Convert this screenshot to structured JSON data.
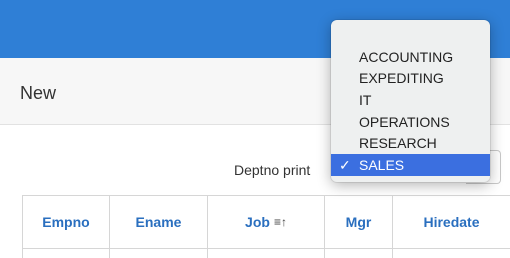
{
  "header": {
    "new_title": "New"
  },
  "filter": {
    "label": "Deptno print",
    "options": [
      "ACCOUNTING",
      "EXPEDITING",
      "IT",
      "OPERATIONS",
      "RESEARCH",
      "SALES"
    ],
    "selected": "SALES",
    "check_icon": "✓"
  },
  "table": {
    "columns": [
      "Empno",
      "Ename",
      "Job",
      "Mgr",
      "Hiredate"
    ],
    "sort_icon": "sort-ascending-icon"
  },
  "colors": {
    "header_bar": "#2f7fd6",
    "link_blue": "#2a6fbf",
    "selection_blue": "#3b6fe0"
  }
}
